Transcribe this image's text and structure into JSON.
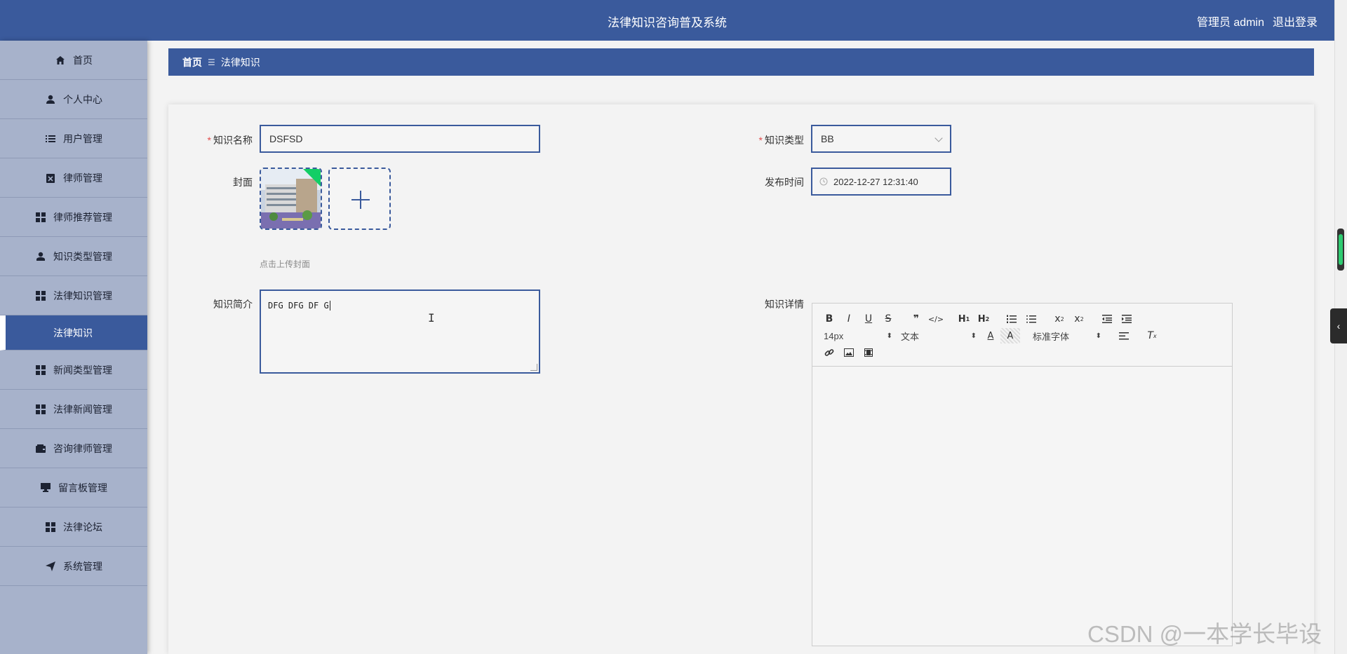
{
  "header": {
    "title": "法律知识咨询普及系统",
    "user": "管理员 admin",
    "logout": "退出登录"
  },
  "sidebar": {
    "items": [
      {
        "label": "首页",
        "icon": "home-icon"
      },
      {
        "label": "个人中心",
        "icon": "user-icon"
      },
      {
        "label": "用户管理",
        "icon": "list-icon"
      },
      {
        "label": "律师管理",
        "icon": "clipboard-icon"
      },
      {
        "label": "律师推荐管理",
        "icon": "grid-icon"
      },
      {
        "label": "知识类型管理",
        "icon": "user-tie-icon"
      },
      {
        "label": "法律知识管理",
        "icon": "grid-icon"
      },
      {
        "label": "法律知识",
        "icon": "",
        "active": true
      },
      {
        "label": "新闻类型管理",
        "icon": "grid-icon"
      },
      {
        "label": "法律新闻管理",
        "icon": "grid-icon"
      },
      {
        "label": "咨询律师管理",
        "icon": "wallet-icon"
      },
      {
        "label": "留言板管理",
        "icon": "monitor-icon"
      },
      {
        "label": "法律论坛",
        "icon": "grid-icon"
      },
      {
        "label": "系统管理",
        "icon": "send-icon"
      }
    ]
  },
  "breadcrumb": {
    "home": "首页",
    "separator": "☰",
    "current": "法律知识"
  },
  "form": {
    "name_label": "知识名称",
    "name_value": "DSFSD",
    "type_label": "知识类型",
    "type_value": "BB",
    "cover_label": "封面",
    "publish_label": "发布时间",
    "publish_value": "2022-12-27 12:31:40",
    "upload_hint": "点击上传封面",
    "intro_label": "知识简介",
    "intro_value": "DFG DFG DF G",
    "detail_label": "知识详情"
  },
  "editor": {
    "font_size": "14px",
    "paragraph": "文本",
    "font_family": "标准字体"
  },
  "watermark": "CSDN @一本学长毕设",
  "colors": {
    "primary": "#3a5a9c",
    "sidebar": "#a7b2cb",
    "required": "#e24d4d",
    "success": "#13ce66"
  }
}
